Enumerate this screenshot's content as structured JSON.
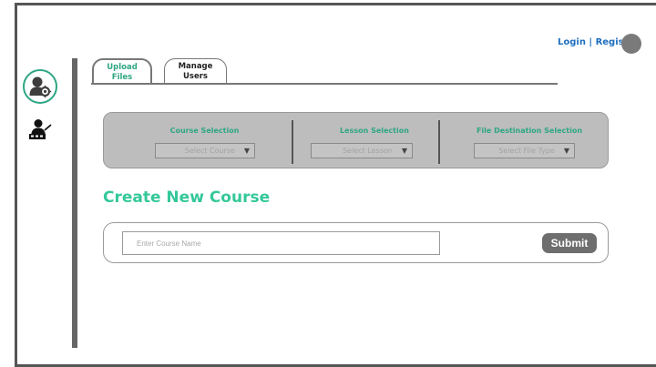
{
  "header": {
    "login_label": "Login",
    "separator": " | ",
    "register_label": "Register"
  },
  "sidebar": {
    "icons": [
      "user-gear-icon",
      "teacher-icon"
    ],
    "accent": "#2ea683"
  },
  "tabs": [
    {
      "line1": "Upload",
      "line2": "Files",
      "active": true
    },
    {
      "line1": "Manage",
      "line2": "Users",
      "active": false
    }
  ],
  "selection": {
    "course": {
      "label": "Course Selection",
      "placeholder": "Select Course"
    },
    "lesson": {
      "label": "Lesson Selection",
      "placeholder": "Select Lesson"
    },
    "file": {
      "label": "File Destination Selection",
      "placeholder": "Select File Type"
    },
    "arrow": "▼"
  },
  "create": {
    "title": "Create New Course",
    "input_placeholder": "Enter Course Name",
    "input_value": "",
    "submit_label": "Submit"
  },
  "colors": {
    "accent_green": "#34c89a",
    "link_blue": "#1f6fbf",
    "panel_gray": "#bdbdbd"
  }
}
